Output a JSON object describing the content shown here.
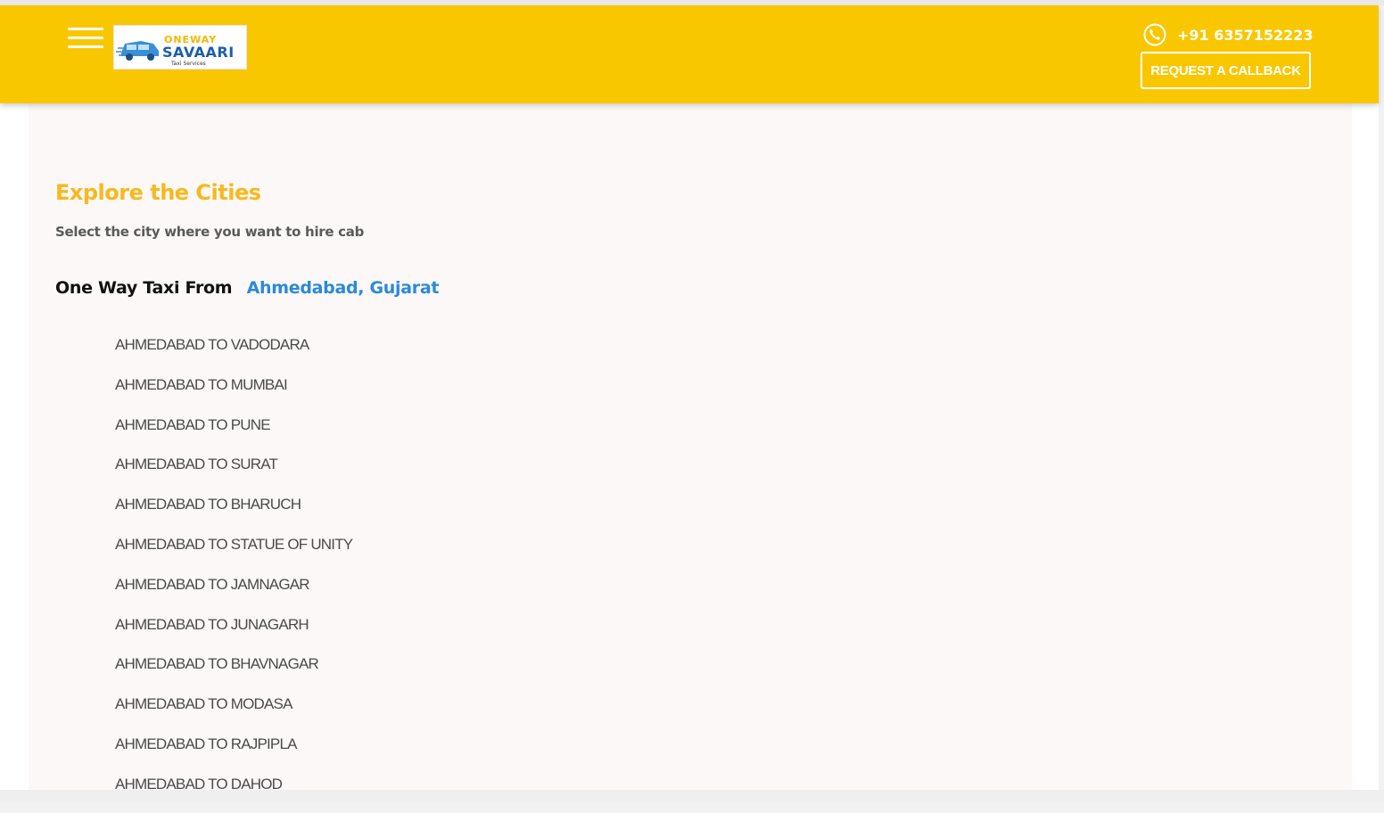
{
  "header": {
    "menu_icon": "hamburger-menu-icon",
    "logo": {
      "line1": "ONEWAY",
      "line2": "SAVAARI",
      "line3": "Taxi Services"
    },
    "phone_icon": "phone-icon",
    "phone_number": "+91 6357152223",
    "callback_label": "REQUEST A CALLBACK"
  },
  "main": {
    "title": "Explore the Cities",
    "subtitle": "Select the city where you want to hire cab",
    "from_label": "One Way Taxi From",
    "from_city": "Ahmedabad, Gujarat",
    "routes": [
      "AHMEDABAD TO VADODARA",
      "AHMEDABAD TO MUMBAI",
      "AHMEDABAD TO PUNE",
      "AHMEDABAD TO SURAT",
      "AHMEDABAD TO BHARUCH",
      "AHMEDABAD TO STATUE OF UNITY",
      "AHMEDABAD TO JAMNAGAR",
      "AHMEDABAD TO JUNAGARH",
      "AHMEDABAD TO BHAVNAGAR",
      "AHMEDABAD TO MODASA",
      "AHMEDABAD TO RAJPIPLA",
      "AHMEDABAD TO DAHOD"
    ]
  },
  "colors": {
    "header_bg": "#f9c700",
    "title": "#f7b91c",
    "link": "#2a8ad8"
  }
}
